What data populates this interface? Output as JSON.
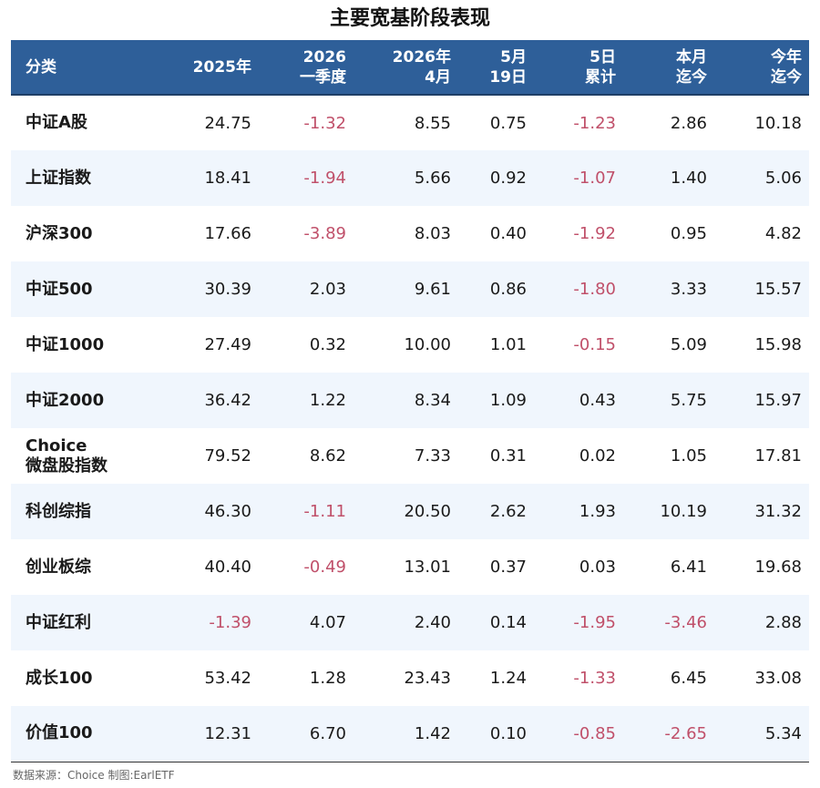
{
  "title": "主要宽基阶段表现",
  "header": [
    [
      "分类"
    ],
    [
      "2025年"
    ],
    [
      "2026",
      "一季度"
    ],
    [
      "2026年",
      "4月"
    ],
    [
      "5月",
      "19日"
    ],
    [
      "5日",
      "累计"
    ],
    [
      "本月",
      "迄今"
    ],
    [
      "今年",
      "迄今"
    ]
  ],
  "rows": [
    {
      "name": [
        "中证A股"
      ],
      "values": [
        "24.75",
        "-1.32",
        "8.55",
        "0.75",
        "-1.23",
        "2.86",
        "10.18"
      ]
    },
    {
      "name": [
        "上证指数"
      ],
      "values": [
        "18.41",
        "-1.94",
        "5.66",
        "0.92",
        "-1.07",
        "1.40",
        "5.06"
      ]
    },
    {
      "name": [
        "沪深300"
      ],
      "values": [
        "17.66",
        "-3.89",
        "8.03",
        "0.40",
        "-1.92",
        "0.95",
        "4.82"
      ]
    },
    {
      "name": [
        "中证500"
      ],
      "values": [
        "30.39",
        "2.03",
        "9.61",
        "0.86",
        "-1.80",
        "3.33",
        "15.57"
      ]
    },
    {
      "name": [
        "中证1000"
      ],
      "values": [
        "27.49",
        "0.32",
        "10.00",
        "1.01",
        "-0.15",
        "5.09",
        "15.98"
      ]
    },
    {
      "name": [
        "中证2000"
      ],
      "values": [
        "36.42",
        "1.22",
        "8.34",
        "1.09",
        "0.43",
        "5.75",
        "15.97"
      ]
    },
    {
      "name": [
        "Choice",
        "微盘股指数"
      ],
      "values": [
        "79.52",
        "8.62",
        "7.33",
        "0.31",
        "0.02",
        "1.05",
        "17.81"
      ]
    },
    {
      "name": [
        "科创综指"
      ],
      "values": [
        "46.30",
        "-1.11",
        "20.50",
        "2.62",
        "1.93",
        "10.19",
        "31.32"
      ]
    },
    {
      "name": [
        "创业板综"
      ],
      "values": [
        "40.40",
        "-0.49",
        "13.01",
        "0.37",
        "0.03",
        "6.41",
        "19.68"
      ]
    },
    {
      "name": [
        "中证红利"
      ],
      "values": [
        "-1.39",
        "4.07",
        "2.40",
        "0.14",
        "-1.95",
        "-3.46",
        "2.88"
      ]
    },
    {
      "name": [
        "成长100"
      ],
      "values": [
        "53.42",
        "1.28",
        "23.43",
        "1.24",
        "-1.33",
        "6.45",
        "33.08"
      ]
    },
    {
      "name": [
        "价值100"
      ],
      "values": [
        "12.31",
        "6.70",
        "1.42",
        "0.10",
        "-0.85",
        "-2.65",
        "5.34"
      ]
    }
  ],
  "source": "数据来源：Choice 制图:EarlETF",
  "colors": {
    "header_bg": "#2e5f99",
    "negative_text": "#c0506a",
    "row_alt_bg": "#f0f6fd"
  }
}
